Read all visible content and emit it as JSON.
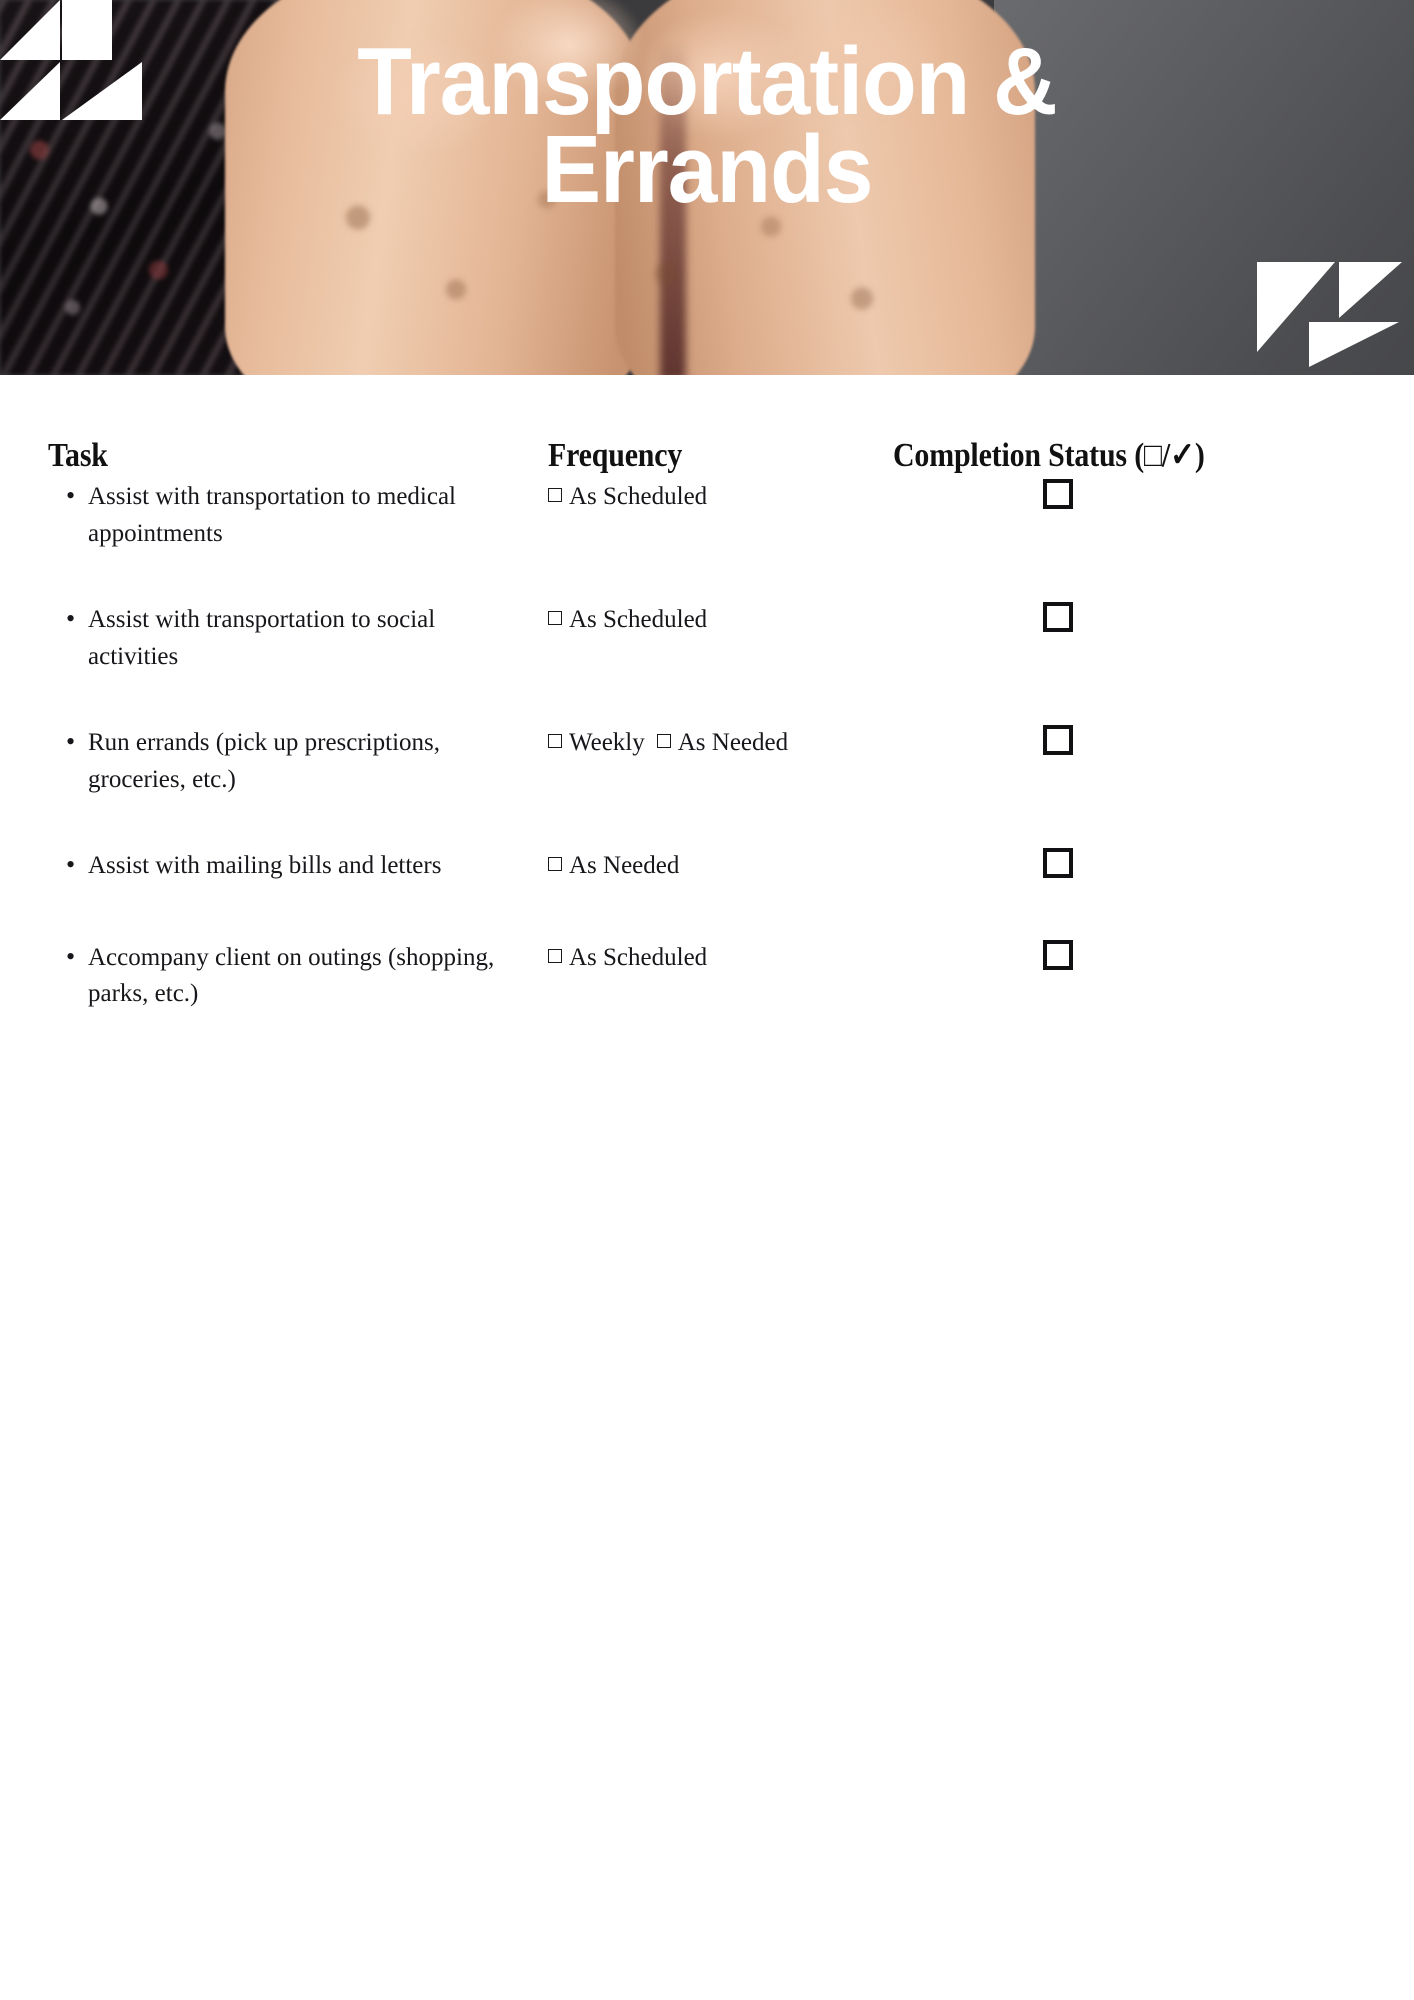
{
  "header": {
    "title": "Transportation &\nErrands",
    "deco_top_left": "triangle-pattern",
    "deco_bottom_right": "triangle-pattern"
  },
  "table": {
    "columns": [
      {
        "key": "task",
        "label": "Task"
      },
      {
        "key": "freq",
        "label": "Frequency"
      },
      {
        "key": "status",
        "label": "Completion Status (□/✓)"
      }
    ],
    "rows": [
      {
        "task": "Assist with transportation to medical appointments",
        "frequency": [
          "As Scheduled"
        ],
        "status_checked": false
      },
      {
        "task": "Assist with transportation to social activities",
        "frequency": [
          "As Scheduled"
        ],
        "status_checked": false
      },
      {
        "task": "Run errands (pick up prescriptions, groceries, etc.)",
        "frequency": [
          "Weekly",
          "As Needed"
        ],
        "status_checked": false
      },
      {
        "task": "Assist with mailing bills and letters",
        "frequency": [
          "As Needed"
        ],
        "status_checked": false
      },
      {
        "task": "Accompany client on outings (shopping, parks, etc.)",
        "frequency": [
          "As Scheduled"
        ],
        "status_checked": false
      }
    ]
  },
  "colors": {
    "page_background": "#ffffff",
    "text": "#17161a",
    "heading": "#111111",
    "banner_gray": "#57585b",
    "banner_dark": "#1a1417",
    "deco_white": "#ffffff",
    "checkbox_border": "#111114"
  }
}
